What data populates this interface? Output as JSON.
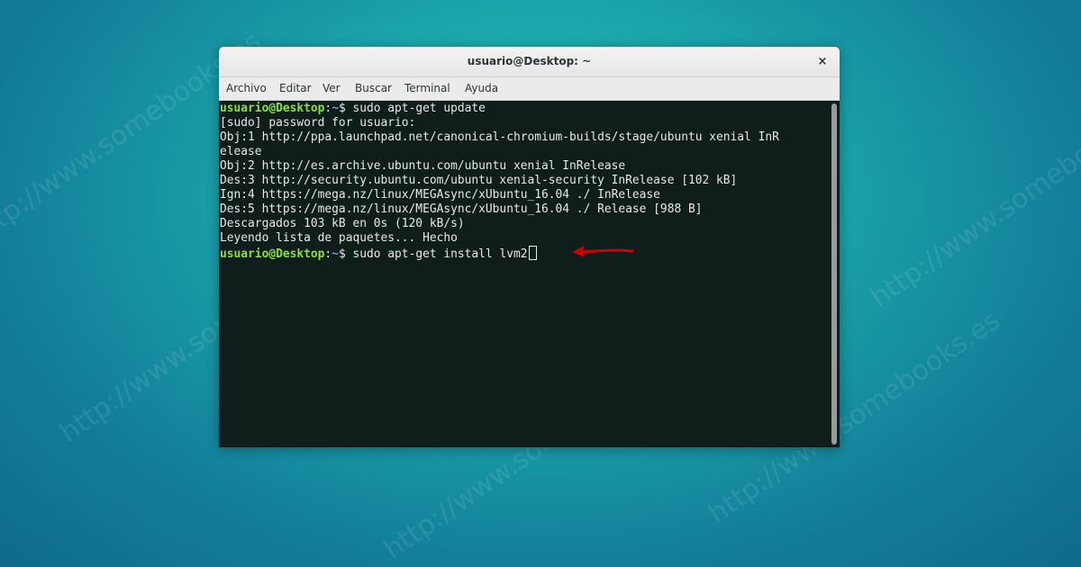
{
  "window": {
    "title": "usuario@Desktop: ~",
    "close_label": "×"
  },
  "menu": [
    {
      "label": "Archivo"
    },
    {
      "label": "Editar"
    },
    {
      "label": "Ver"
    },
    {
      "label": "Buscar"
    },
    {
      "label": "Terminal"
    },
    {
      "label": "Ayuda"
    }
  ],
  "terminal": {
    "prompt_user": "usuario@Desktop",
    "prompt_path": "~",
    "prompt_symbol": "$ ",
    "cmd_1": "sudo apt-get update",
    "cmd_2": "sudo apt-get install lvm2",
    "output": [
      "[sudo] password for usuario:",
      "Obj:1 http://ppa.launchpad.net/canonical-chromium-builds/stage/ubuntu xenial InR",
      "elease",
      "Obj:2 http://es.archive.ubuntu.com/ubuntu xenial InRelease",
      "Des:3 http://security.ubuntu.com/ubuntu xenial-security InRelease [102 kB]",
      "Ign:4 https://mega.nz/linux/MEGAsync/xUbuntu_16.04 ./ InRelease",
      "Des:5 https://mega.nz/linux/MEGAsync/xUbuntu_16.04 ./ Release [988 B]",
      "Descargados 103 kB en 0s (120 kB/s)",
      "Leyendo lista de paquetes... Hecho"
    ]
  },
  "watermark": "http://www.somebooks.es",
  "colors": {
    "prompt_user": "#8ae234",
    "prompt_path": "#729fcf",
    "terminal_bg": "#0f1d1b",
    "arrow": "#d40000"
  }
}
